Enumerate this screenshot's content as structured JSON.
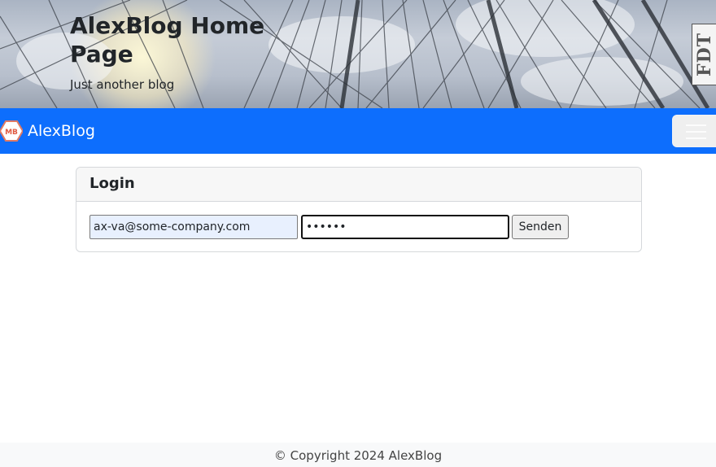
{
  "header": {
    "title": "AlexBlog Home Page",
    "subtitle": "Just another blog",
    "badge_text": "FDT"
  },
  "navbar": {
    "logo_text": "MB",
    "brand": "AlexBlog",
    "toggler_icon": "hamburger-menu-icon",
    "background_color": "#0d6efd"
  },
  "login": {
    "title": "Login",
    "email_value": "ax-va@some-company.com",
    "password_value": "••••••",
    "submit_label": "Senden"
  },
  "footer": {
    "copyright": "© Copyright 2024 AlexBlog"
  }
}
